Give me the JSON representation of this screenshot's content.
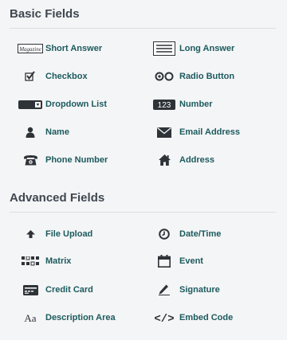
{
  "basic": {
    "title": "Basic Fields",
    "items": [
      {
        "label": "Short Answer",
        "icon": "short-answer-icon",
        "icon_text": "Magazine"
      },
      {
        "label": "Long Answer",
        "icon": "long-answer-icon"
      },
      {
        "label": "Checkbox",
        "icon": "checkbox-icon"
      },
      {
        "label": "Radio Button",
        "icon": "radio-button-icon"
      },
      {
        "label": "Dropdown List",
        "icon": "dropdown-icon"
      },
      {
        "label": "Number",
        "icon": "number-icon",
        "icon_text": "123"
      },
      {
        "label": "Name",
        "icon": "person-icon"
      },
      {
        "label": "Email Address",
        "icon": "envelope-icon"
      },
      {
        "label": "Phone Number",
        "icon": "telephone-icon"
      },
      {
        "label": "Address",
        "icon": "home-icon"
      }
    ]
  },
  "advanced": {
    "title": "Advanced Fields",
    "items": [
      {
        "label": "File Upload",
        "icon": "upload-arrow-icon"
      },
      {
        "label": "Date/Time",
        "icon": "clock-icon"
      },
      {
        "label": "Matrix",
        "icon": "matrix-icon"
      },
      {
        "label": "Event",
        "icon": "calendar-icon"
      },
      {
        "label": "Credit Card",
        "icon": "credit-card-icon"
      },
      {
        "label": "Signature",
        "icon": "pen-icon"
      },
      {
        "label": "Description Area",
        "icon": "text-aa-icon",
        "icon_text": "Aa"
      },
      {
        "label": "Embed Code",
        "icon": "embed-code-icon",
        "icon_text": "</>"
      }
    ]
  },
  "colors": {
    "label": "#1c5a5e",
    "title": "#3f4750",
    "background": "#f4f5f6"
  }
}
